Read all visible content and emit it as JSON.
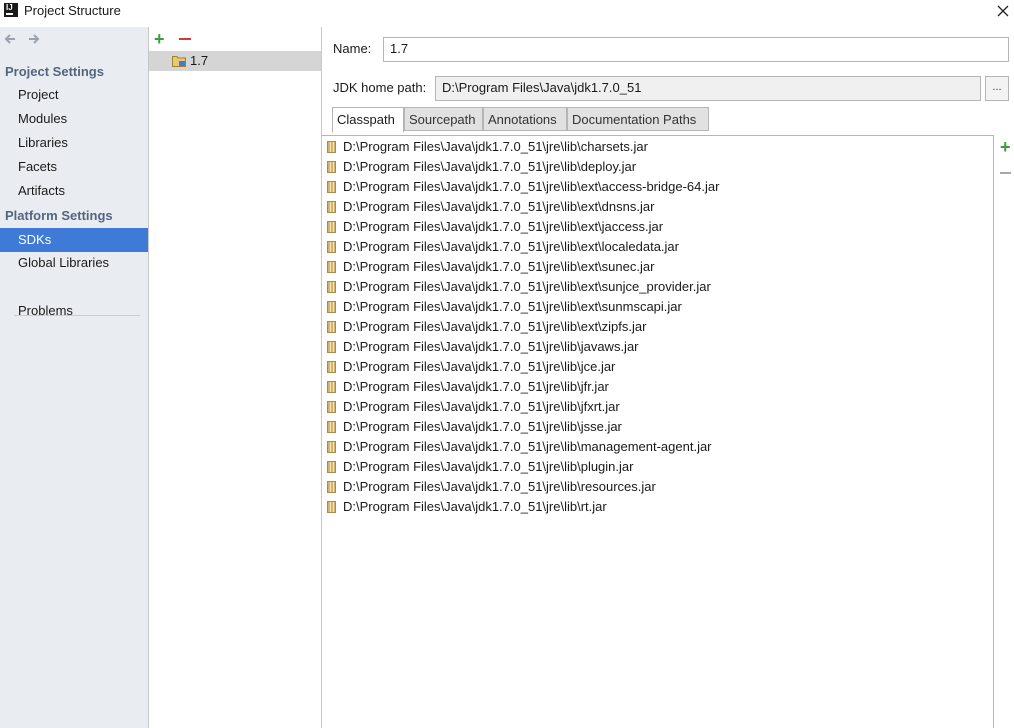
{
  "window": {
    "title": "Project Structure",
    "app_icon_text": "IJ"
  },
  "nav": {
    "back_icon": "back-arrow-icon",
    "forward_icon": "forward-arrow-icon",
    "project_settings_header": "Project Settings",
    "project_settings_items": [
      "Project",
      "Modules",
      "Libraries",
      "Facets",
      "Artifacts"
    ],
    "platform_settings_header": "Platform Settings",
    "platform_settings_items": [
      "SDKs",
      "Global Libraries"
    ],
    "selected_item": "SDKs",
    "problems_label": "Problems"
  },
  "sdk_list": {
    "add_icon": "plus-icon",
    "remove_icon": "minus-icon",
    "items": [
      "1.7"
    ]
  },
  "sdk_detail": {
    "name_label": "Name:",
    "name_value": "1.7",
    "jdk_home_label": "JDK home path:",
    "jdk_home_value": "D:\\Program Files\\Java\\jdk1.7.0_51",
    "browse_label": "...",
    "tabs": [
      "Classpath",
      "Sourcepath",
      "Annotations",
      "Documentation Paths"
    ],
    "active_tab": "Classpath",
    "classpath": [
      "D:\\Program Files\\Java\\jdk1.7.0_51\\jre\\lib\\charsets.jar",
      "D:\\Program Files\\Java\\jdk1.7.0_51\\jre\\lib\\deploy.jar",
      "D:\\Program Files\\Java\\jdk1.7.0_51\\jre\\lib\\ext\\access-bridge-64.jar",
      "D:\\Program Files\\Java\\jdk1.7.0_51\\jre\\lib\\ext\\dnsns.jar",
      "D:\\Program Files\\Java\\jdk1.7.0_51\\jre\\lib\\ext\\jaccess.jar",
      "D:\\Program Files\\Java\\jdk1.7.0_51\\jre\\lib\\ext\\localedata.jar",
      "D:\\Program Files\\Java\\jdk1.7.0_51\\jre\\lib\\ext\\sunec.jar",
      "D:\\Program Files\\Java\\jdk1.7.0_51\\jre\\lib\\ext\\sunjce_provider.jar",
      "D:\\Program Files\\Java\\jdk1.7.0_51\\jre\\lib\\ext\\sunmscapi.jar",
      "D:\\Program Files\\Java\\jdk1.7.0_51\\jre\\lib\\ext\\zipfs.jar",
      "D:\\Program Files\\Java\\jdk1.7.0_51\\jre\\lib\\javaws.jar",
      "D:\\Program Files\\Java\\jdk1.7.0_51\\jre\\lib\\jce.jar",
      "D:\\Program Files\\Java\\jdk1.7.0_51\\jre\\lib\\jfr.jar",
      "D:\\Program Files\\Java\\jdk1.7.0_51\\jre\\lib\\jfxrt.jar",
      "D:\\Program Files\\Java\\jdk1.7.0_51\\jre\\lib\\jsse.jar",
      "D:\\Program Files\\Java\\jdk1.7.0_51\\jre\\lib\\management-agent.jar",
      "D:\\Program Files\\Java\\jdk1.7.0_51\\jre\\lib\\plugin.jar",
      "D:\\Program Files\\Java\\jdk1.7.0_51\\jre\\lib\\resources.jar",
      "D:\\Program Files\\Java\\jdk1.7.0_51\\jre\\lib\\rt.jar"
    ],
    "side_add_icon": "plus-icon",
    "side_remove_icon": "minus-icon"
  },
  "colors": {
    "selection": "#3e7ad6",
    "nav_background": "#e9edf2",
    "section_header": "#536680",
    "add_green": "#3a9c3a",
    "remove_red": "#d03a3a"
  }
}
